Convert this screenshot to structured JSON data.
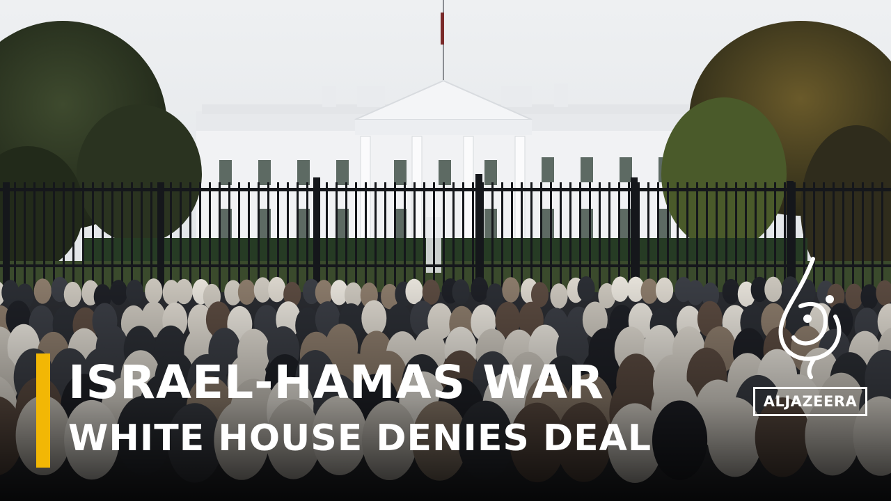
{
  "scene": {
    "description_colors": {
      "sky": "#e9ebed",
      "building": "#f1f2f4",
      "fence": "#15171b",
      "lawn": "#3a4a2c",
      "accent": "#f2b705"
    }
  },
  "overlay": {
    "headline": "ISRAEL-HAMAS WAR",
    "subheadline": "WHITE HOUSE DENIES DEAL"
  },
  "logo": {
    "wordmark": "ALJAZEERA",
    "calligraphy": "الجزيرة"
  }
}
